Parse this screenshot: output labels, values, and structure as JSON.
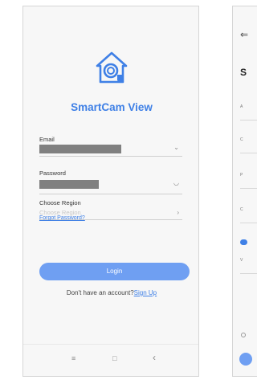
{
  "app": {
    "name": "SmartCam View",
    "brand_color": "#3f80e6"
  },
  "login": {
    "email_label": "Email",
    "password_label": "Password",
    "region_label": "Choose Region",
    "region_placeholder": "Choose Region",
    "forgot_label": "Forgot Password?",
    "login_label": "Login",
    "no_account_text": "Don't have an account?",
    "signup_label": "Sign Up"
  },
  "navbar": {
    "menu_icon": "≡",
    "home_icon": "□",
    "back_icon": "‹"
  },
  "right_screen": {
    "back_icon": "⇐",
    "title_fragment": "S"
  }
}
